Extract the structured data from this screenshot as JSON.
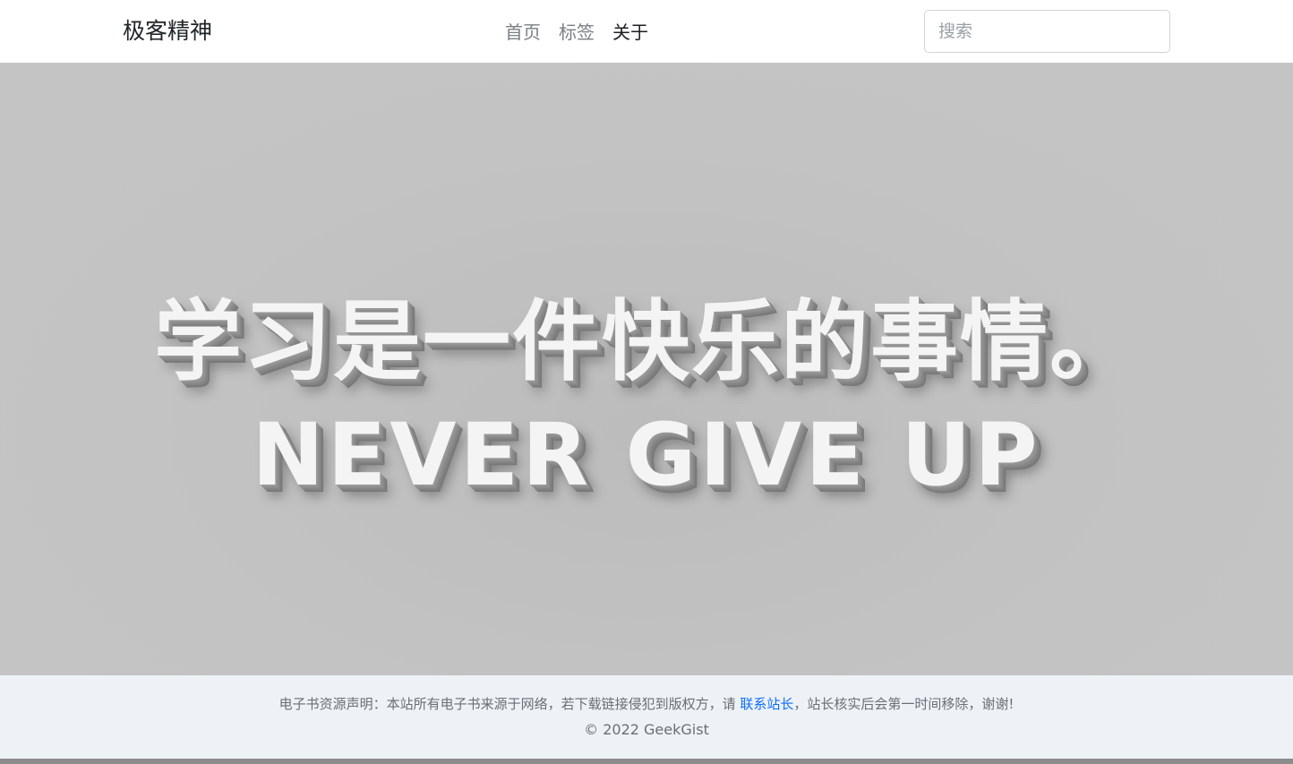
{
  "nav": {
    "brand": "极客精神",
    "links": [
      {
        "label": "首页",
        "active": false
      },
      {
        "label": "标签",
        "active": false
      },
      {
        "label": "关于",
        "active": true
      }
    ],
    "search_placeholder": "搜索"
  },
  "hero": {
    "line1": "学习是一件快乐的事情。",
    "line2": "NEVER GIVE UP"
  },
  "footer": {
    "notice_prefix": "电子书资源声明：本站所有电子书来源于网络，若下载链接侵犯到版权方，请 ",
    "notice_link": "联系站长",
    "notice_suffix": "，站长核实后会第一时间移除，谢谢!",
    "copyright": "© 2022 GeekGist"
  },
  "colors": {
    "hero_background": "#c4c4c4",
    "footer_background": "#eef2f7",
    "link": "#0d6efd"
  }
}
